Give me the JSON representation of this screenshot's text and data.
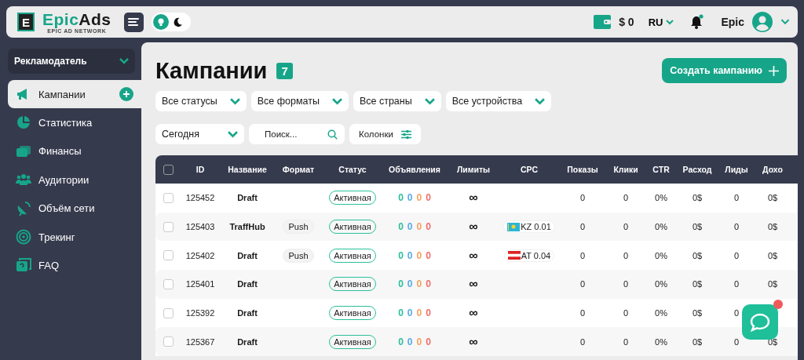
{
  "header": {
    "logo": {
      "letter": "E",
      "brand_a": "Epic",
      "brand_b": "Ads",
      "tagline": "EPIC AD NETWORK"
    },
    "dark_mode": false,
    "balance": "$ 0",
    "language": "RU",
    "notifications_unread": true,
    "user": "Epic"
  },
  "sidebar": {
    "role": "Рекламодатель",
    "items": [
      {
        "label": "Кампании",
        "selected": true
      },
      {
        "label": "Статистика",
        "selected": false
      },
      {
        "label": "Финансы",
        "selected": false
      },
      {
        "label": "Аудитории",
        "selected": false
      },
      {
        "label": "Объём сети",
        "selected": false
      },
      {
        "label": "Трекинг",
        "selected": false
      },
      {
        "label": "FAQ",
        "selected": false
      }
    ]
  },
  "page": {
    "title": "Кампании",
    "count": "7",
    "create_button": "Создать кампанию"
  },
  "filters": [
    "Все статусы",
    "Все форматы",
    "Все страны",
    "Все устройства"
  ],
  "period": "Сегодня",
  "search": {
    "placeholder": "Поиск..."
  },
  "columns_button": "Колонки",
  "table": {
    "all_checked": false,
    "columns": [
      "ID",
      "Название",
      "Формат",
      "Статус",
      "Объявления",
      "Лимиты",
      "CPC",
      "Показы",
      "Клики",
      "CTR",
      "Расход",
      "Лиды",
      "Дохо"
    ],
    "rows": [
      {
        "checked": false,
        "id": "125452",
        "name": "Draft",
        "status": "Активная",
        "ads": [
          {
            "value": "0",
            "color": "#2bbf9b"
          },
          {
            "value": "0",
            "color": "#5aa9e6"
          },
          {
            "value": "0",
            "color": "#f5a25d"
          },
          {
            "value": "0",
            "color": "#ef6f6c"
          }
        ],
        "limit": "∞",
        "impressions": "0",
        "clicks": "0",
        "ctr": "0%",
        "spend": "0$",
        "leads": "0",
        "income": "0$"
      },
      {
        "checked": false,
        "id": "125403",
        "name": "TraffHub",
        "format": "Push",
        "status": "Активная",
        "ads": [
          {
            "value": "0",
            "color": "#2bbf9b"
          },
          {
            "value": "0",
            "color": "#5aa9e6"
          },
          {
            "value": "0",
            "color": "#f5a25d"
          },
          {
            "value": "0",
            "color": "#ef6f6c"
          }
        ],
        "limit": "∞",
        "cpc": {
          "text": "KZ 0.01"
        },
        "impressions": "0",
        "clicks": "0",
        "ctr": "0%",
        "spend": "0$",
        "leads": "0",
        "income": "0$"
      },
      {
        "checked": false,
        "id": "125402",
        "name": "Draft",
        "format": "Push",
        "status": "Активная",
        "ads": [
          {
            "value": "0",
            "color": "#2bbf9b"
          },
          {
            "value": "0",
            "color": "#5aa9e6"
          },
          {
            "value": "0",
            "color": "#f5a25d"
          },
          {
            "value": "0",
            "color": "#ef6f6c"
          }
        ],
        "limit": "∞",
        "cpc": {
          "text": "AT 0.04"
        },
        "impressions": "0",
        "clicks": "0",
        "ctr": "0%",
        "spend": "0$",
        "leads": "0",
        "income": "0$"
      },
      {
        "checked": false,
        "id": "125401",
        "name": "Draft",
        "status": "Активная",
        "ads": [
          {
            "value": "0",
            "color": "#2bbf9b"
          },
          {
            "value": "0",
            "color": "#5aa9e6"
          },
          {
            "value": "0",
            "color": "#f5a25d"
          },
          {
            "value": "0",
            "color": "#ef6f6c"
          }
        ],
        "limit": "∞",
        "impressions": "0",
        "clicks": "0",
        "ctr": "0%",
        "spend": "0$",
        "leads": "0",
        "income": "0$"
      },
      {
        "checked": false,
        "id": "125392",
        "name": "Draft",
        "status": "Активная",
        "ads": [
          {
            "value": "0",
            "color": "#2bbf9b"
          },
          {
            "value": "0",
            "color": "#5aa9e6"
          },
          {
            "value": "0",
            "color": "#f5a25d"
          },
          {
            "value": "0",
            "color": "#ef6f6c"
          }
        ],
        "limit": "∞",
        "impressions": "0",
        "clicks": "0",
        "ctr": "0%",
        "spend": "0$",
        "leads": "0"
      },
      {
        "checked": false,
        "id": "125367",
        "name": "Draft",
        "status": "Активная",
        "ads": [
          {
            "value": "0",
            "color": "#2bbf9b"
          },
          {
            "value": "0",
            "color": "#5aa9e6"
          },
          {
            "value": "0",
            "color": "#f5a25d"
          },
          {
            "value": "0",
            "color": "#ef6f6c"
          }
        ],
        "limit": "∞",
        "impressions": "0",
        "clicks": "0",
        "ctr": "0%",
        "spend": "0$",
        "leads": "0",
        "income": "0$"
      }
    ]
  },
  "chat": {
    "unread": true
  }
}
